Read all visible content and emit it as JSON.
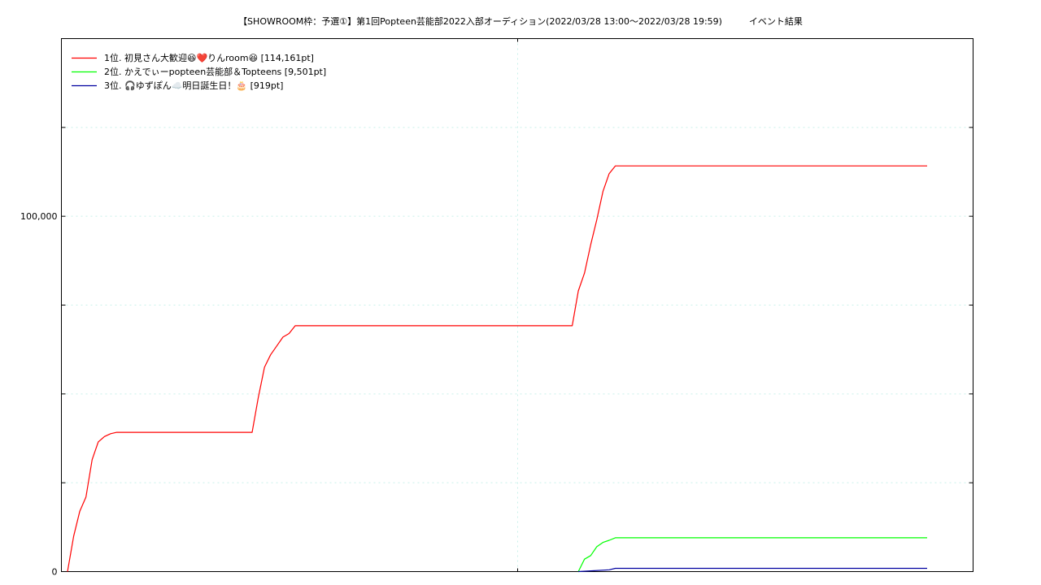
{
  "chart_data": {
    "type": "line",
    "title": "【SHOWROOM枠：予選①】第1回Popteen芸能部2022入部オーディション(2022/03/28 13:00〜2022/03/28 19:59)　　　イベント結果",
    "xlabel": "",
    "ylabel": "",
    "x_range": [
      "2022/03/28 13:00",
      "2022/03/28 19:59"
    ],
    "ylim": [
      0,
      150000
    ],
    "yticks": [
      0,
      100000
    ],
    "ytick_labels": [
      "0",
      "100,000"
    ],
    "grid": true,
    "legend_position": "top-left",
    "series": [
      {
        "name": "1位. 初見さん大歓迎😆❤️りんroom😆 [114,161pt]",
        "color": "#ff0000",
        "points": [
          [
            "13:00",
            0
          ],
          [
            "13:03",
            10000
          ],
          [
            "13:06",
            17000
          ],
          [
            "13:09",
            21000
          ],
          [
            "13:12",
            31500
          ],
          [
            "13:15",
            36500
          ],
          [
            "13:18",
            38000
          ],
          [
            "13:21",
            38800
          ],
          [
            "13:24",
            39200
          ],
          [
            "14:30",
            39200
          ],
          [
            "14:33",
            49000
          ],
          [
            "14:36",
            57500
          ],
          [
            "14:39",
            61000
          ],
          [
            "14:42",
            63500
          ],
          [
            "14:45",
            66000
          ],
          [
            "14:48",
            67000
          ],
          [
            "14:51",
            69200
          ],
          [
            "17:06",
            69200
          ],
          [
            "17:09",
            79000
          ],
          [
            "17:12",
            84000
          ],
          [
            "17:15",
            92000
          ],
          [
            "17:18",
            99000
          ],
          [
            "17:21",
            107000
          ],
          [
            "17:24",
            112000
          ],
          [
            "17:27",
            114161
          ],
          [
            "19:59",
            114161
          ]
        ]
      },
      {
        "name": "2位. かえでぃーpopteen芸能部＆Topteens [9,501pt]",
        "color": "#00ff00",
        "points": [
          [
            "17:09",
            0
          ],
          [
            "17:12",
            3500
          ],
          [
            "17:15",
            4500
          ],
          [
            "17:18",
            7000
          ],
          [
            "17:21",
            8200
          ],
          [
            "17:24",
            8800
          ],
          [
            "17:27",
            9501
          ],
          [
            "19:59",
            9501
          ]
        ]
      },
      {
        "name": "3位. 🎧ゆずぽん☁️明日誕生日！🎂 [919pt]",
        "color": "#0000a0",
        "points": [
          [
            "17:09",
            0
          ],
          [
            "17:15",
            200
          ],
          [
            "17:24",
            500
          ],
          [
            "17:27",
            919
          ],
          [
            "19:59",
            919
          ]
        ]
      }
    ]
  }
}
